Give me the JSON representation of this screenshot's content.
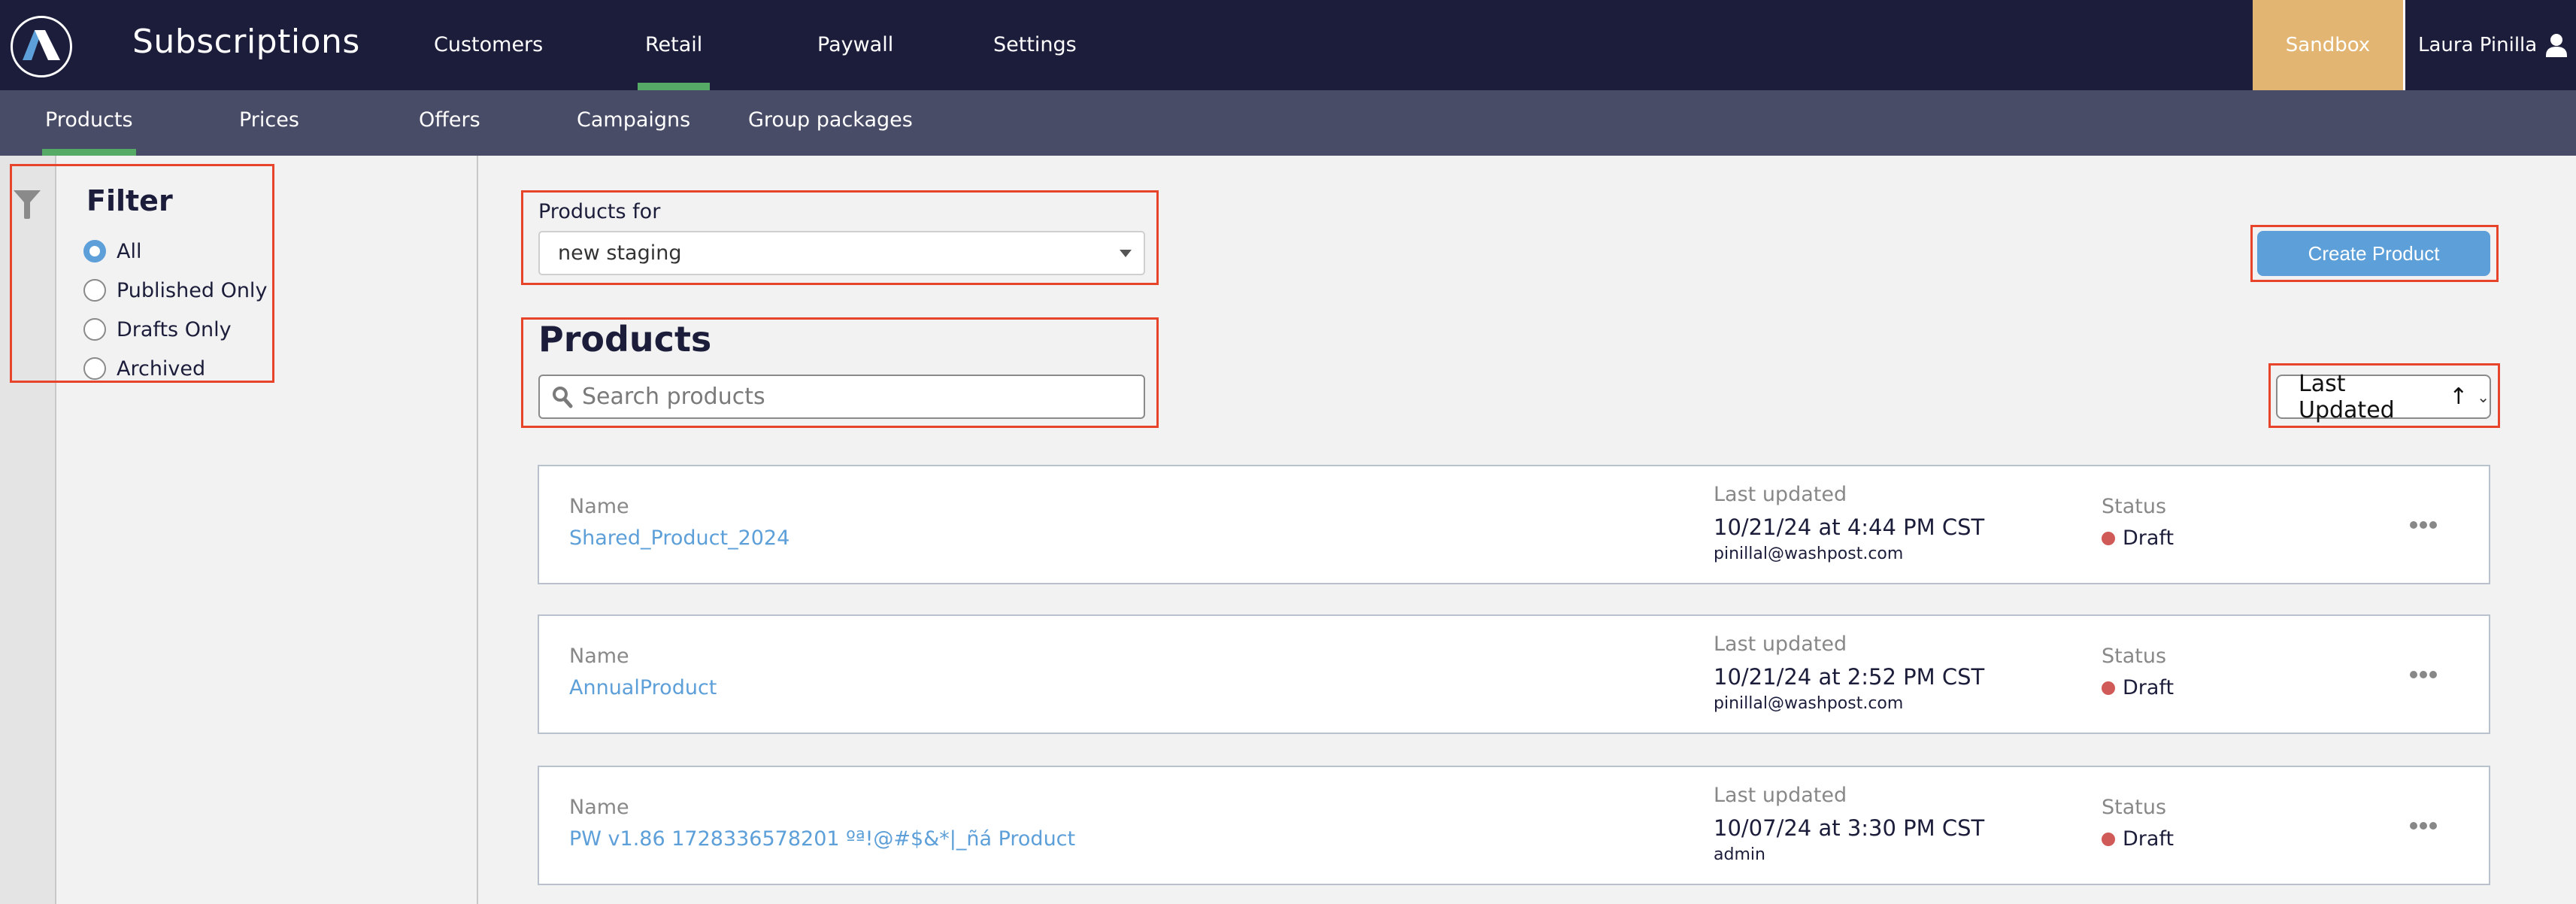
{
  "header": {
    "app_title": "Subscriptions",
    "nav": [
      {
        "label": "Customers",
        "active": false
      },
      {
        "label": "Retail",
        "active": true
      },
      {
        "label": "Paywall",
        "active": false
      },
      {
        "label": "Settings",
        "active": false
      }
    ],
    "environment_badge": "Sandbox",
    "user_name": "Laura Pinilla"
  },
  "subnav": [
    {
      "label": "Products",
      "active": true
    },
    {
      "label": "Prices",
      "active": false
    },
    {
      "label": "Offers",
      "active": false
    },
    {
      "label": "Campaigns",
      "active": false
    },
    {
      "label": "Group packages",
      "active": false
    }
  ],
  "filter": {
    "title": "Filter",
    "options": [
      {
        "label": "All",
        "checked": true
      },
      {
        "label": "Published Only",
        "checked": false
      },
      {
        "label": "Drafts Only",
        "checked": false
      },
      {
        "label": "Archived",
        "checked": false
      }
    ]
  },
  "main": {
    "products_for_label": "Products for",
    "products_for_value": "new staging",
    "heading": "Products",
    "search_placeholder": "Search products",
    "search_value": "",
    "create_button": "Create Product",
    "sort_label": "Last Updated",
    "sort_direction_icon": "↑"
  },
  "products": {
    "labels": {
      "name": "Name",
      "last_updated": "Last updated",
      "status": "Status"
    },
    "items": [
      {
        "name": "Shared_Product_2024",
        "updated": "10/21/24 at 4:44 PM CST",
        "updated_by": "pinillal@washpost.com",
        "status": "Draft"
      },
      {
        "name": "AnnualProduct",
        "updated": "10/21/24 at 2:52 PM CST",
        "updated_by": "pinillal@washpost.com",
        "status": "Draft"
      },
      {
        "name": "PW v1.86 1728336578201 ºª!@#$&*|_ñá Product",
        "updated": "10/07/24 at 3:30 PM CST",
        "updated_by": "admin",
        "status": "Draft"
      }
    ]
  },
  "colors": {
    "header_bg": "#1c1d3b",
    "subnav_bg": "#484c66",
    "active_underline": "#55aa66",
    "sandbox_bg": "#e2b672",
    "primary": "#5d9fd8",
    "draft_status": "#d05a58",
    "annotation": "#e8442b"
  }
}
